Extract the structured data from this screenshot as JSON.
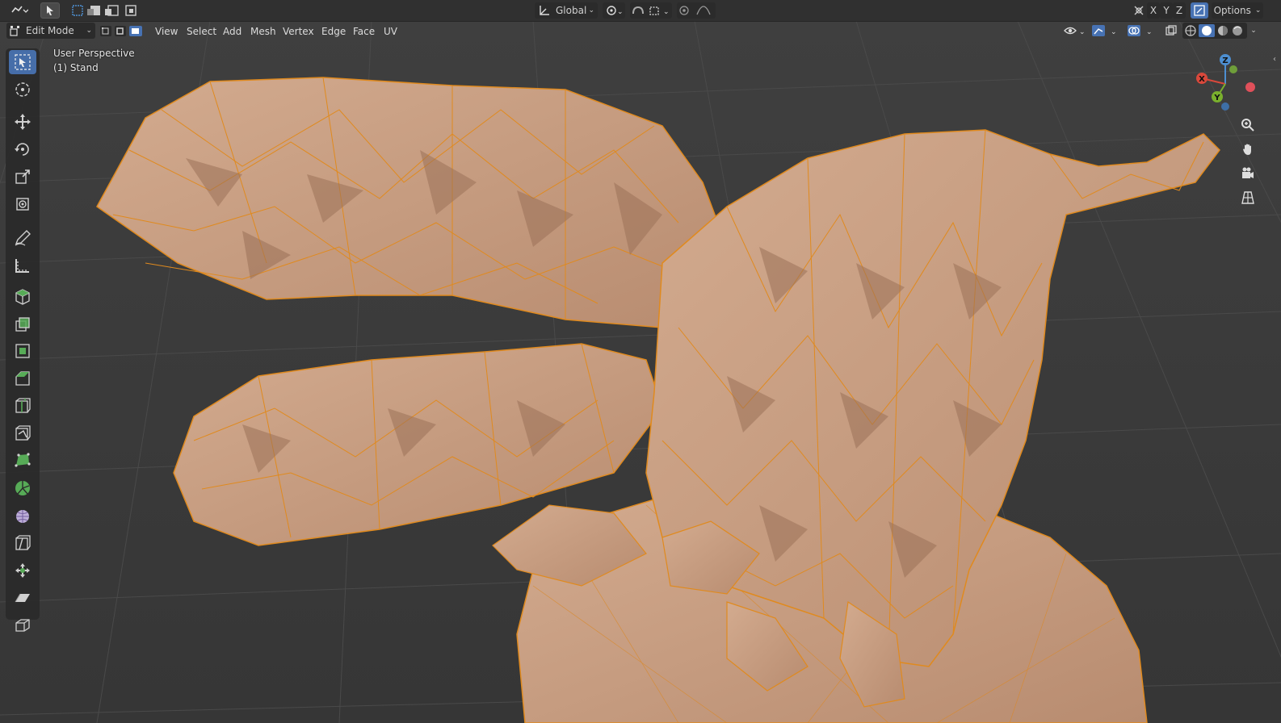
{
  "header": {
    "orientation": "Global",
    "options_label": "Options",
    "axis_x": "X",
    "axis_y": "Y",
    "axis_z": "Z"
  },
  "mode_bar": {
    "mode": "Edit Mode",
    "menus": [
      "View",
      "Select",
      "Add",
      "Mesh",
      "Vertex",
      "Edge",
      "Face",
      "UV"
    ]
  },
  "viewport": {
    "view_name": "User Perspective",
    "object_name": "(1) Stand"
  },
  "gizmo": {
    "x": "X",
    "y": "Y",
    "z": "Z"
  },
  "tools": [
    "select-box",
    "cursor",
    "move",
    "rotate",
    "scale",
    "transform",
    "annotate",
    "measure",
    "add-cube",
    "extrude",
    "inset",
    "bevel",
    "loop-cut",
    "knife",
    "poly-build",
    "spin",
    "smooth",
    "edge-slide",
    "shrink-fatten",
    "shear",
    "rip"
  ],
  "colors": {
    "accent": "#4772b3",
    "mesh_fill": "#c49a7f",
    "mesh_edge": "#e08a1e",
    "grid": "#474747"
  }
}
